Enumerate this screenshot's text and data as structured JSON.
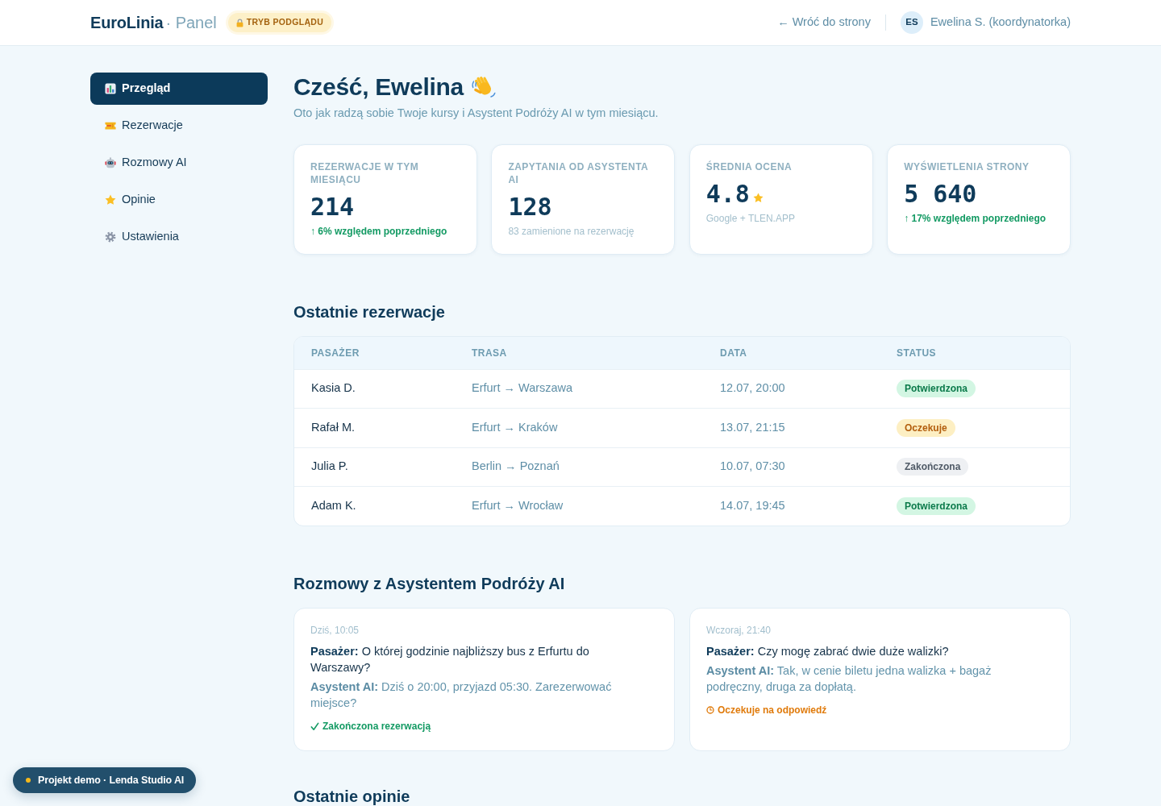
{
  "header": {
    "brand": "EuroLinia",
    "brand_suffix": "· Panel",
    "mode_badge": "TRYB PODGLĄDU",
    "back_link": "← Wróć do strony",
    "user": {
      "initials": "ES",
      "name": "Ewelina S. (koordynatorka)"
    }
  },
  "sidebar": {
    "items": [
      {
        "label": "Przegląd",
        "kind": "overview",
        "selected": true
      },
      {
        "label": "Rezerwacje",
        "kind": "bookings",
        "selected": false
      },
      {
        "label": "Rozmowy AI",
        "kind": "chats",
        "selected": false
      },
      {
        "label": "Opinie",
        "kind": "reviews",
        "selected": false
      },
      {
        "label": "Ustawienia",
        "kind": "settings",
        "selected": false
      }
    ]
  },
  "greeting": {
    "title": "Cześć, Ewelina",
    "subtitle": "Oto jak radzą sobie Twoje kursy i Asystent Podróży AI w tym miesiącu."
  },
  "stats": [
    {
      "label": "REZERWACJE W TYM MIESIĄCU",
      "value": "214",
      "note": "↑ 6% względem poprzedniego",
      "kind": "trend"
    },
    {
      "label": "ZAPYTANIA OD ASYSTENTA AI",
      "value": "128",
      "note": "83 zamienione na rezerwację",
      "kind": "plain"
    },
    {
      "label": "ŚREDNIA OCENA",
      "value": "4.8",
      "note": "Google + TLEN.APP",
      "kind": "rating"
    },
    {
      "label": "WYŚWIETLENIA STRONY",
      "value": "5 640",
      "note": "↑ 17% względem poprzedniego",
      "kind": "trend"
    }
  ],
  "bookings": {
    "title": "Ostatnie rezerwacje",
    "columns": [
      "PASAŻER",
      "TRASA",
      "DATA",
      "STATUS"
    ],
    "rows": [
      {
        "passenger": "Kasia D.",
        "route": "Erfurt → Warszawa",
        "date": "12.07, 20:00",
        "status": {
          "label": "Potwierdzona",
          "kind": "confirmed"
        }
      },
      {
        "passenger": "Rafał M.",
        "route": "Erfurt → Kraków",
        "date": "13.07, 21:15",
        "status": {
          "label": "Oczekuje",
          "kind": "pending"
        }
      },
      {
        "passenger": "Julia P.",
        "route": "Berlin → Poznań",
        "date": "10.07, 07:30",
        "status": {
          "label": "Zakończona",
          "kind": "finished"
        }
      },
      {
        "passenger": "Adam K.",
        "route": "Erfurt → Wrocław",
        "date": "14.07, 19:45",
        "status": {
          "label": "Potwierdzona",
          "kind": "confirmed"
        }
      }
    ]
  },
  "conversations": {
    "title": "Rozmowy z Asystentem Podróży AI",
    "items": [
      {
        "time": "Dziś, 10:05",
        "passenger": "**Pasażer:** O której godzinie najbliższy bus z Erfurtu do Warszawy?",
        "assistant": "**Asystent AI:** Dziś o 20:00, przyjazd 05:30. Zarezerwować miejsce?",
        "outcome": {
          "label": "Zakończona rezerwacją",
          "kind": "booked"
        }
      },
      {
        "time": "Wczoraj, 21:40",
        "passenger": "**Pasażer:** Czy mogę zabrać dwie duże walizki?",
        "assistant": "**Asystent AI:** Tak, w cenie biletu jedna walizka + bagaż podręczny, druga za dopłatą.",
        "outcome": {
          "label": "Oczekuje na odpowiedź",
          "kind": "waiting"
        }
      }
    ]
  },
  "reviews": {
    "title": "Ostatnie opinie"
  },
  "demo_badge": {
    "label": "Projekt demo · Lenda Studio AI"
  }
}
